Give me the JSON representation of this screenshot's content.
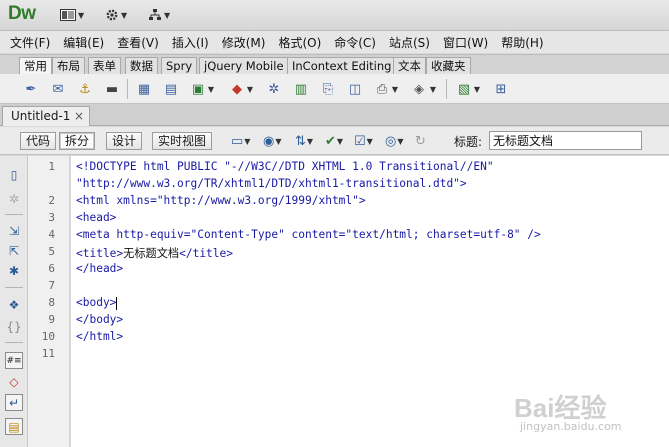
{
  "app": {
    "logo": "Dw"
  },
  "titlebar": {
    "buttons": [
      {
        "icon": "layout-icon"
      },
      {
        "icon": "gear-icon"
      },
      {
        "icon": "site-icon"
      }
    ]
  },
  "menu": [
    "文件(F)",
    "编辑(E)",
    "查看(V)",
    "插入(I)",
    "修改(M)",
    "格式(O)",
    "命令(C)",
    "站点(S)",
    "窗口(W)",
    "帮助(H)"
  ],
  "insert_tabs": [
    {
      "label": "常用",
      "active": true
    },
    {
      "label": "布局"
    },
    {
      "label": "表单"
    },
    {
      "label": "数据"
    },
    {
      "label": "Spry"
    },
    {
      "label": "jQuery Mobile"
    },
    {
      "label": "InContext Editing"
    },
    {
      "label": "文本"
    },
    {
      "label": "收藏夹"
    }
  ],
  "document": {
    "tab_label": "Untitled-1",
    "close_glyph": "×",
    "views": {
      "code": "代码",
      "split": "拆分",
      "design": "设计",
      "live": "实时视图"
    },
    "title_label": "标题:",
    "title_value": "无标题文档"
  },
  "code": {
    "line_numbers": [
      "1",
      "2",
      "3",
      "4",
      "5",
      "6",
      "7",
      "8",
      "9",
      "10",
      "11"
    ],
    "lines": [
      "<!DOCTYPE html PUBLIC \"-//W3C//DTD XHTML 1.0 Transitional//EN\"",
      "\"http://www.w3.org/TR/xhtml1/DTD/xhtml1-transitional.dtd\">",
      "<html xmlns=\"http://www.w3.org/1999/xhtml\">",
      "<head>",
      "<meta http-equiv=\"Content-Type\" content=\"text/html; charset=utf-8\" />",
      "<title>",
      "无标题文档",
      "</title>",
      "</head>",
      "",
      "<body>",
      "</body>",
      "</html>"
    ]
  },
  "watermark": {
    "text": "Bai经验",
    "sub": "jingyan.baidu.com"
  },
  "colors": {
    "logo": "#2f7d2a",
    "tag": "#1a1aa6",
    "toolbar_icon": "#2d5c97"
  }
}
